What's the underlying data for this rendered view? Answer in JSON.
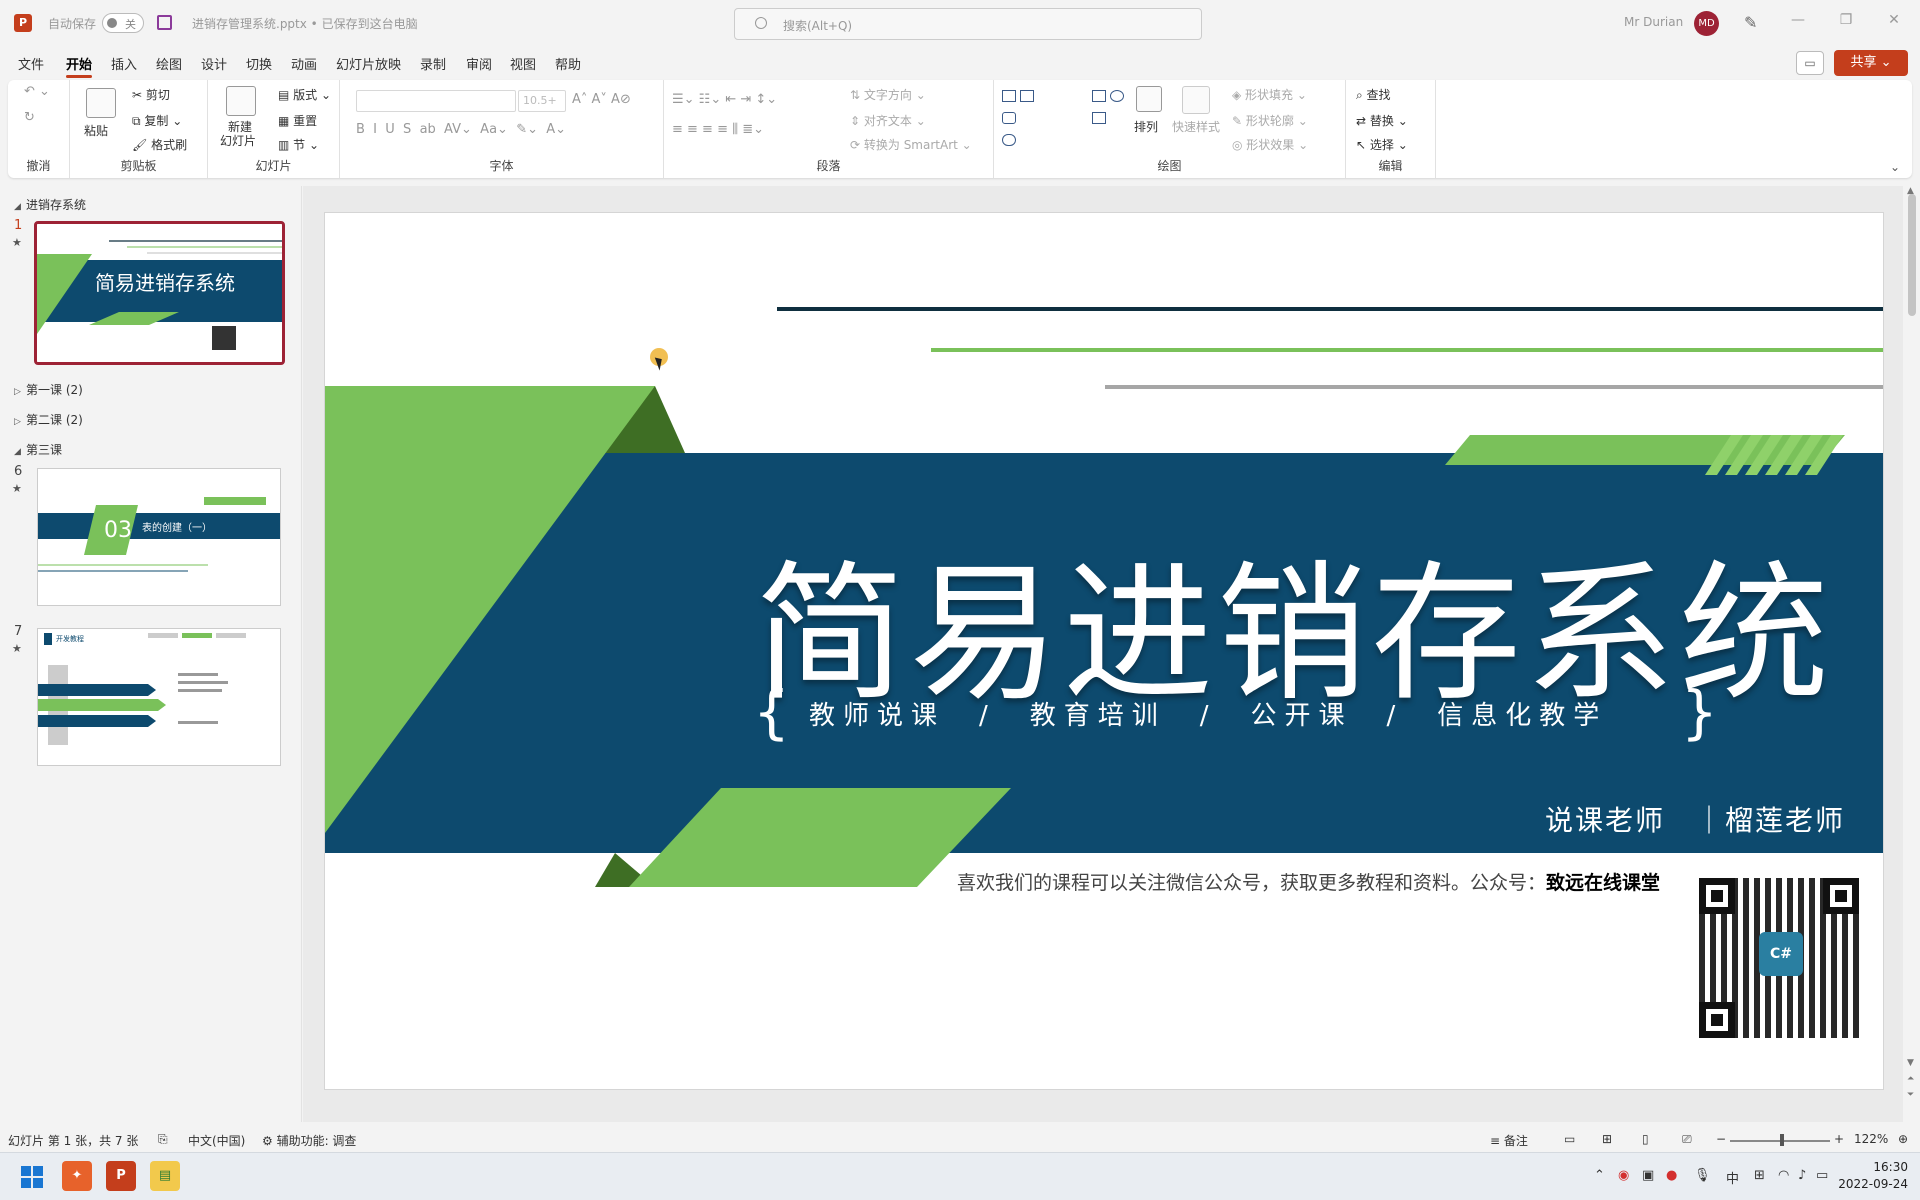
{
  "titlebar": {
    "app_icon": "P",
    "autosave_label": "自动保存",
    "autosave_state": "关",
    "filename": "进销存管理系统.pptx • 已保存到这台电脑",
    "search_placeholder": "搜索(Alt+Q)",
    "user_name": "Mr Durian",
    "user_initials": "MD",
    "window_controls": [
      "—",
      "❐",
      "✕"
    ]
  },
  "menubar": {
    "items": [
      "文件",
      "开始",
      "插入",
      "绘图",
      "设计",
      "切换",
      "动画",
      "幻灯片放映",
      "录制",
      "审阅",
      "视图",
      "帮助"
    ],
    "active": "开始",
    "share_label": "共享"
  },
  "ribbon": {
    "groups": {
      "undo": "撤消",
      "clipboard": "剪贴板",
      "slides": "幻灯片",
      "font": "字体",
      "paragraph": "段落",
      "drawing": "绘图",
      "editing": "编辑"
    },
    "clipboard": {
      "paste": "粘贴",
      "cut": "剪切",
      "copy": "复制",
      "format_painter": "格式刷"
    },
    "slides": {
      "new_slide_1": "新建",
      "new_slide_2": "幻灯片",
      "layout": "版式",
      "reset": "重置",
      "section": "节"
    },
    "font": {
      "font_size": "10.5+"
    },
    "paragraph": {
      "text_direction": "文字方向",
      "align_text": "对齐文本",
      "smartart": "转换为 SmartArt"
    },
    "drawing": {
      "arrange": "排列",
      "quick_styles": "快速样式",
      "shape_fill": "形状填充",
      "shape_outline": "形状轮廓",
      "shape_effects": "形状效果"
    },
    "editing": {
      "find": "查找",
      "replace": "替换",
      "select": "选择"
    }
  },
  "slide_panel": {
    "sections": [
      {
        "name": "进销存系统",
        "expanded": true
      },
      {
        "name": "第一课 (2)",
        "expanded": false
      },
      {
        "name": "第二课 (2)",
        "expanded": false
      },
      {
        "name": "第三课",
        "expanded": true
      }
    ],
    "slides": [
      {
        "number": "1",
        "star": "★",
        "title": "简易进销存系统",
        "selected": true
      },
      {
        "number": "6",
        "star": "★",
        "badge": "03",
        "title": "表的创建（一）"
      },
      {
        "number": "7",
        "star": "★",
        "title": "开发教程"
      }
    ]
  },
  "slide": {
    "title": "简易进销存系统",
    "subtitle": "教师说课　/　教育培训　/　公开课　/　信息化教学",
    "brace_left": "{",
    "brace_right": "}",
    "teacher": "说课老师　｜榴莲老师",
    "footer_text": "喜欢我们的课程可以关注微信公众号，获取更多教程和资料。公众号：",
    "footer_bold": "致远在线课堂",
    "qr_logo": "C#",
    "colors": {
      "navy": "#0d4a6e",
      "green": "#7ac15a",
      "dark_green": "#3e6e24",
      "dark_line": "#0f2f3f",
      "gray_line": "#a6a6a6"
    }
  },
  "statusbar": {
    "slide_info": "幻灯片 第 1 张，共 7 张",
    "language": "中文(中国)",
    "accessibility": "辅助功能: 调查",
    "notes": "备注",
    "zoom": "122%"
  },
  "taskbar": {
    "ime": "中",
    "time": "16:30",
    "date": "2022-09-24"
  }
}
